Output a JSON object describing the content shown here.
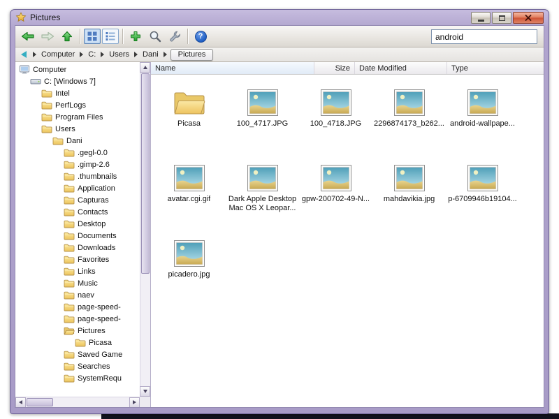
{
  "window": {
    "title": "Pictures"
  },
  "toolbar": {
    "search_value": "android",
    "help_glyph": "?"
  },
  "breadcrumb": {
    "items": [
      "Computer",
      "C:",
      "Users",
      "Dani"
    ],
    "current": "Pictures"
  },
  "columns": {
    "name": "Name",
    "size": "Size",
    "date_modified": "Date Modified",
    "type": "Type"
  },
  "tree": {
    "items": [
      {
        "label": "Computer",
        "level": 0,
        "icon": "computer"
      },
      {
        "label": "C: [Windows 7]",
        "level": 1,
        "icon": "drive"
      },
      {
        "label": "Intel",
        "level": 2,
        "icon": "folder"
      },
      {
        "label": "PerfLogs",
        "level": 2,
        "icon": "folder"
      },
      {
        "label": "Program Files",
        "level": 2,
        "icon": "folder"
      },
      {
        "label": "Users",
        "level": 2,
        "icon": "folder"
      },
      {
        "label": "Dani",
        "level": 3,
        "icon": "folder"
      },
      {
        "label": ".gegl-0.0",
        "level": 4,
        "icon": "folder"
      },
      {
        "label": ".gimp-2.6",
        "level": 4,
        "icon": "folder"
      },
      {
        "label": ".thumbnails",
        "level": 4,
        "icon": "folder"
      },
      {
        "label": "Application",
        "level": 4,
        "icon": "folder"
      },
      {
        "label": "Capturas",
        "level": 4,
        "icon": "folder"
      },
      {
        "label": "Contacts",
        "level": 4,
        "icon": "folder"
      },
      {
        "label": "Desktop",
        "level": 4,
        "icon": "folder"
      },
      {
        "label": "Documents",
        "level": 4,
        "icon": "folder"
      },
      {
        "label": "Downloads",
        "level": 4,
        "icon": "folder"
      },
      {
        "label": "Favorites",
        "level": 4,
        "icon": "folder"
      },
      {
        "label": "Links",
        "level": 4,
        "icon": "folder"
      },
      {
        "label": "Music",
        "level": 4,
        "icon": "folder"
      },
      {
        "label": "naev",
        "level": 4,
        "icon": "folder"
      },
      {
        "label": "page-speed-",
        "level": 4,
        "icon": "folder"
      },
      {
        "label": "page-speed-",
        "level": 4,
        "icon": "folder"
      },
      {
        "label": "Pictures",
        "level": 4,
        "icon": "folder-open",
        "current": true
      },
      {
        "label": "Picasa",
        "level": 5,
        "icon": "folder"
      },
      {
        "label": "Saved Game",
        "level": 4,
        "icon": "folder"
      },
      {
        "label": "Searches",
        "level": 4,
        "icon": "folder"
      },
      {
        "label": "SystemRequ",
        "level": 4,
        "icon": "folder"
      }
    ]
  },
  "files": [
    {
      "name": "Picasa",
      "icon": "folder"
    },
    {
      "name": "100_4717.JPG",
      "icon": "image"
    },
    {
      "name": "100_4718.JPG",
      "icon": "image"
    },
    {
      "name": "2296874173_b262...",
      "icon": "image"
    },
    {
      "name": "android-wallpape...",
      "icon": "image"
    },
    {
      "name": "avatar.cgi.gif",
      "icon": "image"
    },
    {
      "name": "Dark Apple Desktop Mac OS X Leopar...",
      "icon": "image"
    },
    {
      "name": "gpw-200702-49-N...",
      "icon": "image"
    },
    {
      "name": "mahdavikia.jpg",
      "icon": "image"
    },
    {
      "name": "p-6709946b19104...",
      "icon": "image"
    },
    {
      "name": "picadero.jpg",
      "icon": "image"
    }
  ],
  "colors": {
    "frame": "#b1a5ce",
    "accent_green": "#23a12c",
    "close_red": "#cf5335",
    "help_blue": "#1e5ec4",
    "folder_yellow": "#eec35e"
  }
}
